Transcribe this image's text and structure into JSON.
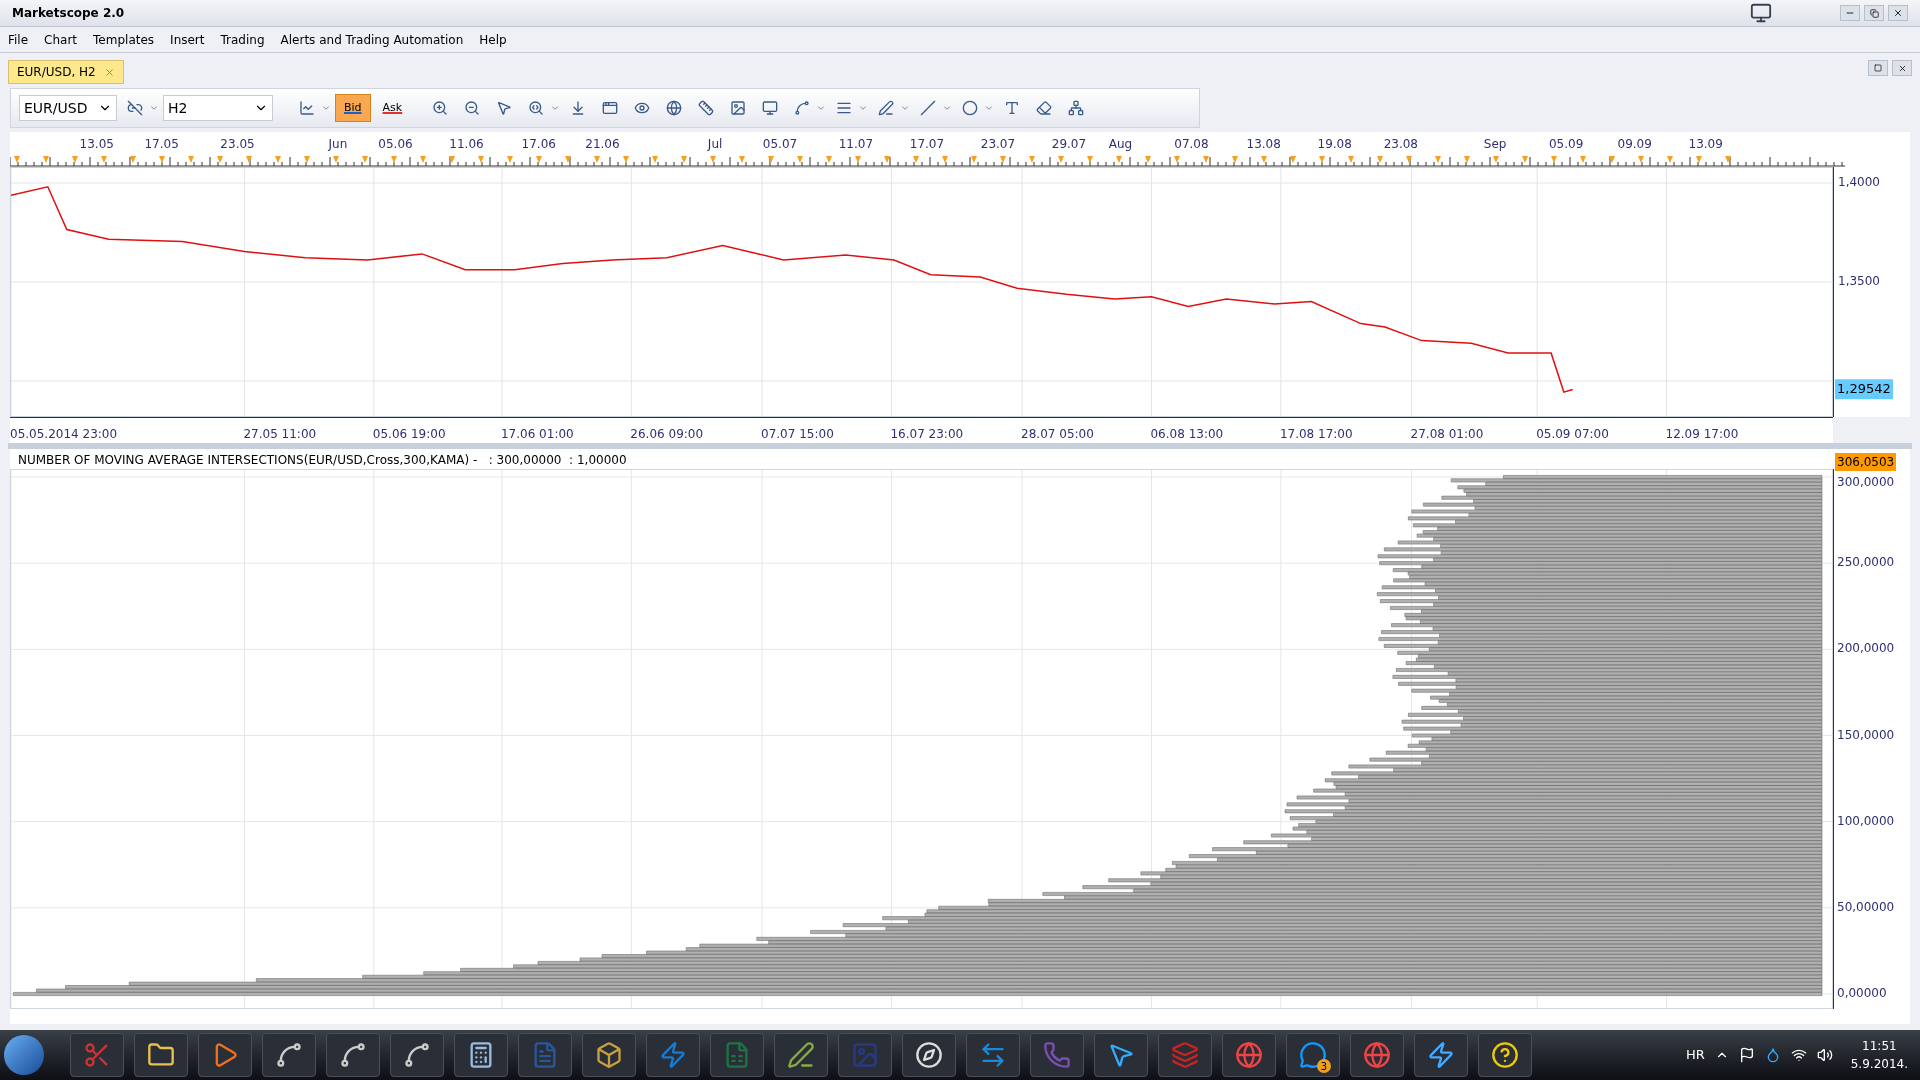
{
  "window": {
    "title": "Marketscope 2.0"
  },
  "menu": [
    "File",
    "Chart",
    "Templates",
    "Insert",
    "Trading",
    "Alerts and Trading Automation",
    "Help"
  ],
  "tabs": [
    {
      "label": "EUR/USD, H2",
      "selected": true
    }
  ],
  "toolbar": {
    "symbol": "EUR/USD",
    "timeframe": "H2",
    "price_modes": [
      {
        "label": "Bid",
        "selected": true
      },
      {
        "label": "Ask",
        "selected": false
      }
    ]
  },
  "top_date_labels": [
    "13.05",
    "17.05",
    "23.05",
    "Jun",
    "05.06",
    "11.06",
    "17.06",
    "21.06",
    "Jul",
    "05.07",
    "11.07",
    "17.07",
    "23.07",
    "29.07",
    "Aug",
    "07.08",
    "13.08",
    "19.08",
    "23.08",
    "Sep",
    "05.09",
    "09.09",
    "13.09"
  ],
  "price_chart": {
    "current_price": "1,29542",
    "y_axis_labels": [
      "1,4000",
      "1,3500"
    ],
    "time_labels": [
      "05.05.2014 23:00",
      "27.05 11:00",
      "05.06 19:00",
      "17.06 01:00",
      "26.06 09:00",
      "07.07 15:00",
      "16.07 23:00",
      "28.07 05:00",
      "06.08 13:00",
      "17.08 17:00",
      "27.08 01:00",
      "05.09 07:00",
      "12.09 17:00"
    ]
  },
  "indicator": {
    "title": "NUMBER OF MOVING AVERAGE INTERSECTIONS(EUR/USD,Cross,300,KAMA) -   : 300,00000  : 1,00000",
    "current_value": "306,0503",
    "axis_labels": [
      "300,0000",
      "250,0000",
      "200,0000",
      "150,0000",
      "100,0000",
      "50,00000",
      "0,00000"
    ]
  },
  "taskbar": {
    "skype_badge": "3",
    "language": "HR",
    "time": "11:51",
    "date": "5.9.2014."
  }
}
